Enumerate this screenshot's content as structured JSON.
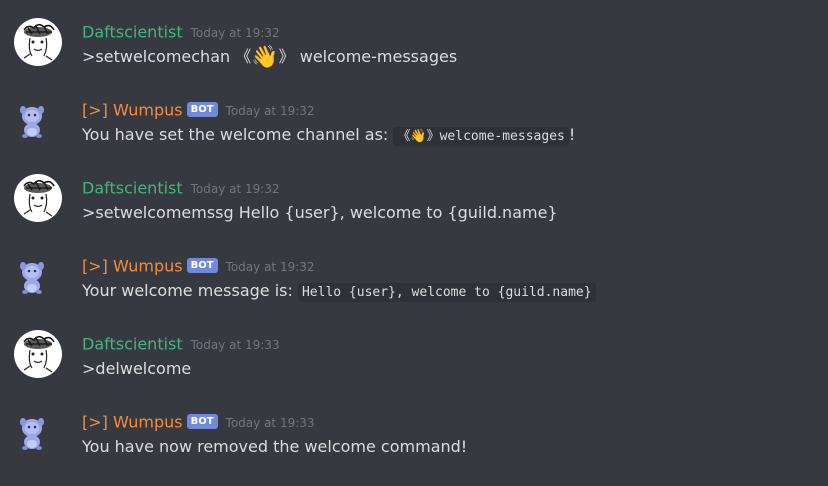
{
  "messages": [
    {
      "author": "Daftscientist",
      "timestamp": "Today at 19:32",
      "text_before": ">setwelcomechan ",
      "bracket_open": "《",
      "emoji": "👋",
      "bracket_close": "》",
      "text_after": " welcome-messages"
    },
    {
      "author": "[>] Wumpus",
      "bot_tag": "BOT",
      "timestamp": "Today at 19:32",
      "text": "You have set the welcome channel as: ",
      "code_bracket_open": "《",
      "code_emoji": "👋",
      "code_bracket_close": "》",
      "code_text": "welcome-messages",
      "text_after": "!"
    },
    {
      "author": "Daftscientist",
      "timestamp": "Today at 19:32",
      "text": ">setwelcomemssg Hello {user}, welcome to {guild.name}"
    },
    {
      "author": "[>] Wumpus",
      "bot_tag": "BOT",
      "timestamp": "Today at 19:32",
      "text": "Your welcome message is: ",
      "code_text": "Hello {user}, welcome to {guild.name}"
    },
    {
      "author": "Daftscientist",
      "timestamp": "Today at 19:33",
      "text": ">delwelcome"
    },
    {
      "author": "[>] Wumpus",
      "bot_tag": "BOT",
      "timestamp": "Today at 19:33",
      "text": "You have now removed the welcome command!"
    }
  ],
  "icons": {
    "user_avatar": "sketch-face-avatar",
    "bot_avatar": "wumpus-avatar"
  },
  "colors": {
    "background": "#36393f",
    "user_name": "#43b581",
    "bot_name": "#f48c3c",
    "bot_tag": "#7289da",
    "timestamp": "#72767d",
    "text": "#dcddde",
    "code_bg": "#2f3136"
  }
}
